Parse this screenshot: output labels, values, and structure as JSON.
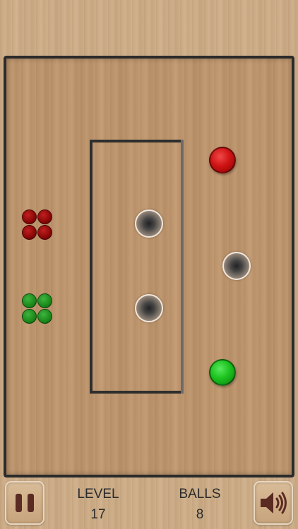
{
  "hud": {
    "level_label": "LEVEL",
    "level_value": "17",
    "balls_label": "BALLS",
    "balls_value": "8"
  },
  "colors": {
    "wood_background": "#cfb08b",
    "board": "#c29a72",
    "wall": "#2e2e2e",
    "red_ball": "#d01414",
    "green_ball": "#1cc41f",
    "icon": "#5a2b22"
  },
  "icons": {
    "pause": "pause-icon",
    "sound": "speaker-icon"
  }
}
